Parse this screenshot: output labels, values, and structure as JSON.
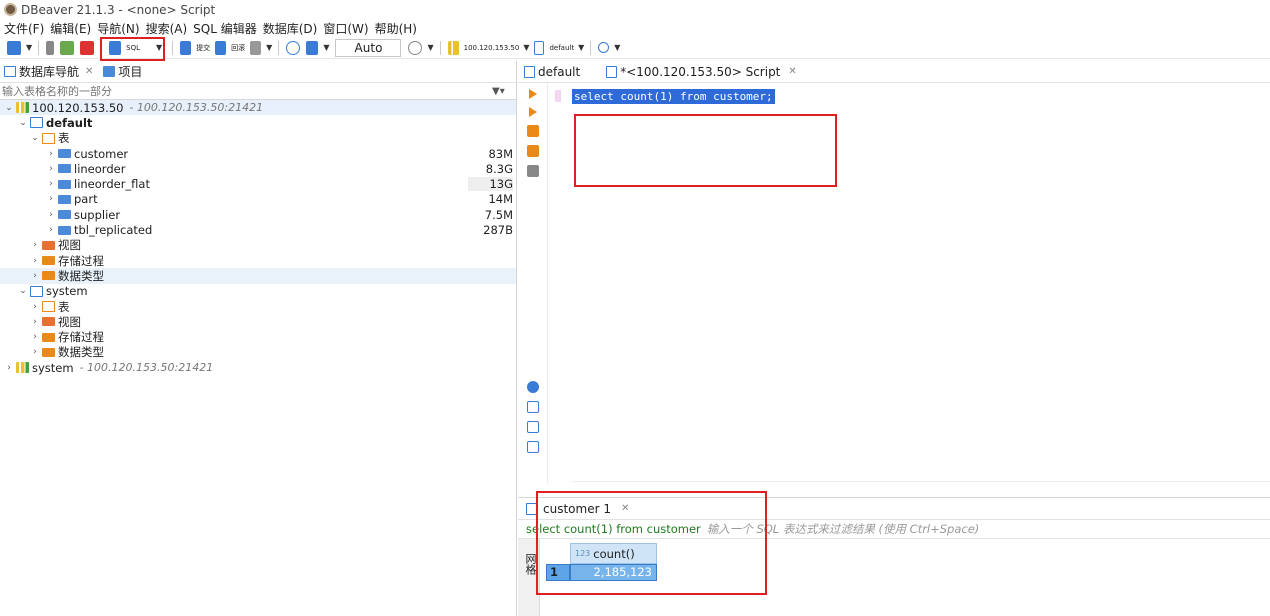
{
  "window": {
    "title": "DBeaver 21.1.3 - <none> Script"
  },
  "menu": [
    "文件(F)",
    "编辑(E)",
    "导航(N)",
    "搜索(A)",
    "SQL 编辑器",
    "数据库(D)",
    "窗口(W)",
    "帮助(H)"
  ],
  "toolbar": {
    "sql_label": "SQL",
    "commit_label": "提交",
    "rollback_label": "回滚",
    "tx_mode": "Auto",
    "connection": "100.120.153.50",
    "schema": "default"
  },
  "navigator": {
    "tab_label": "数据库导航",
    "tab_projects": "项目",
    "filter_placeholder": "输入表格名称的一部分",
    "connection_name": "100.120.153.50",
    "connection_addr": "- 100.120.153.50:21421",
    "default_db": "default",
    "tables_label": "表",
    "tables": [
      {
        "name": "customer",
        "size": "83M"
      },
      {
        "name": "lineorder",
        "size": "8.3G"
      },
      {
        "name": "lineorder_flat",
        "size": "13G"
      },
      {
        "name": "part",
        "size": "14M"
      },
      {
        "name": "supplier",
        "size": "7.5M"
      },
      {
        "name": "tbl_replicated",
        "size": "287B"
      }
    ],
    "views_label": "视图",
    "procs_label": "存储过程",
    "types_label": "数据类型",
    "system_db": "system",
    "system_tables": "表",
    "system_views": "视图",
    "system_procs": "存储过程",
    "system_types": "数据类型",
    "system_conn_name": "system",
    "system_conn_addr": "- 100.120.153.50:21421"
  },
  "editor": {
    "tab_default": "default",
    "tab_script": "*<100.120.153.50> Script",
    "sql": "select count(1) from customer;"
  },
  "results": {
    "tab_label": "customer 1",
    "query": "select count(1) from customer",
    "filter_hint": "输入一个 SQL 表达式来过滤结果 (使用 Ctrl+Space)",
    "column_header": "count()",
    "column_type": "123",
    "row_number": "1",
    "value": "2,185,123",
    "side_label": "网格"
  }
}
